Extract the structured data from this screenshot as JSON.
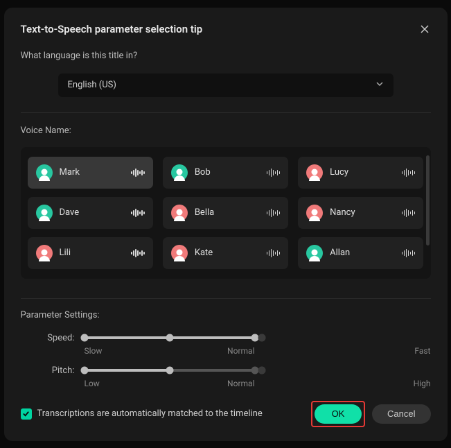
{
  "dialog": {
    "title": "Text-to-Speech parameter selection tip",
    "question": "What language is this title in?",
    "language_selected": "English (US)"
  },
  "voice": {
    "section_label": "Voice Name:",
    "items": [
      {
        "name": "Mark",
        "color": "green",
        "selected": true
      },
      {
        "name": "Bob",
        "color": "green",
        "selected": false
      },
      {
        "name": "Lucy",
        "color": "pink",
        "selected": false
      },
      {
        "name": "Dave",
        "color": "green",
        "selected": false
      },
      {
        "name": "Bella",
        "color": "pink",
        "selected": false
      },
      {
        "name": "Nancy",
        "color": "pink",
        "selected": false
      },
      {
        "name": "Lili",
        "color": "pink",
        "selected": false
      },
      {
        "name": "Kate",
        "color": "pink",
        "selected": false
      },
      {
        "name": "Allan",
        "color": "green",
        "selected": false
      }
    ]
  },
  "params": {
    "section_label": "Parameter Settings:",
    "speed": {
      "label": "Speed:",
      "low": "Slow",
      "mid": "Normal",
      "high": "Fast"
    },
    "pitch": {
      "label": "Pitch:",
      "low": "Low",
      "mid": "Normal",
      "high": "High"
    }
  },
  "footer": {
    "checkbox_label": "Transcriptions are automatically matched to the timeline",
    "checkbox_checked": true,
    "ok_label": "OK",
    "cancel_label": "Cancel"
  },
  "colors": {
    "accent": "#00d4a0",
    "highlight": "#e53935"
  }
}
